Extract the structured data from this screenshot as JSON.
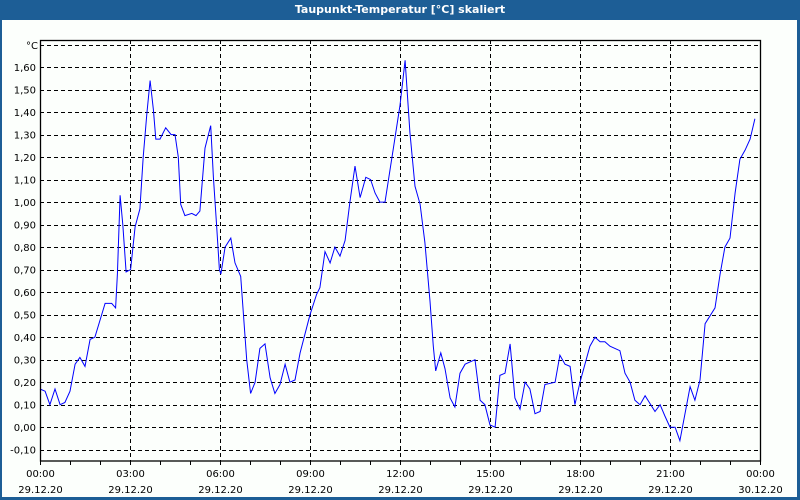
{
  "window": {
    "title": "Taupunkt-Temperatur [°C] skaliert"
  },
  "colors": {
    "titlebar": "#1d5e96",
    "line": "#0000ff",
    "grid": "#000000",
    "background": "#fcfffc"
  },
  "chart_data": {
    "type": "line",
    "title": "Taupunkt-Temperatur [°C] skaliert",
    "ylabel": "°C",
    "xlabel": "",
    "ylim": [
      -0.15,
      1.72
    ],
    "xlim_hours": [
      0,
      24
    ],
    "grid": true,
    "y_ticks": [
      "-0,10",
      "0,00",
      "0,10",
      "0,20",
      "0,30",
      "0,40",
      "0,50",
      "0,60",
      "0,70",
      "0,80",
      "0,90",
      "1,00",
      "1,10",
      "1,20",
      "1,30",
      "1,40",
      "1,50",
      "1,60"
    ],
    "y_tick_values": [
      -0.1,
      0,
      0.1,
      0.2,
      0.3,
      0.4,
      0.5,
      0.6,
      0.7,
      0.8,
      0.9,
      1.0,
      1.1,
      1.2,
      1.3,
      1.4,
      1.5,
      1.6
    ],
    "x_ticks": [
      {
        "hour": 0,
        "time": "00:00",
        "date": "29.12.20"
      },
      {
        "hour": 3,
        "time": "03:00",
        "date": "29.12.20"
      },
      {
        "hour": 6,
        "time": "06:00",
        "date": "29.12.20"
      },
      {
        "hour": 9,
        "time": "09:00",
        "date": "29.12.20"
      },
      {
        "hour": 12,
        "time": "12:00",
        "date": "29.12.20"
      },
      {
        "hour": 15,
        "time": "15:00",
        "date": "29.12.20"
      },
      {
        "hour": 18,
        "time": "18:00",
        "date": "29.12.20"
      },
      {
        "hour": 21,
        "time": "21:00",
        "date": "29.12.20"
      },
      {
        "hour": 24,
        "time": "00:00",
        "date": "30.12.20"
      }
    ],
    "series": [
      {
        "name": "Taupunkt-Temperatur",
        "points": [
          [
            0,
            0.17
          ],
          [
            0.17,
            0.16
          ],
          [
            0.33,
            0.1
          ],
          [
            0.5,
            0.17
          ],
          [
            0.67,
            0.1
          ],
          [
            0.83,
            0.11
          ],
          [
            1,
            0.16
          ],
          [
            1.17,
            0.28
          ],
          [
            1.33,
            0.31
          ],
          [
            1.5,
            0.27
          ],
          [
            1.67,
            0.39
          ],
          [
            1.83,
            0.4
          ],
          [
            2.17,
            0.55
          ],
          [
            2.39,
            0.55
          ],
          [
            2.52,
            0.53
          ],
          [
            2.58,
            0.68
          ],
          [
            2.67,
            1.03
          ],
          [
            2.76,
            0.9
          ],
          [
            2.87,
            0.69
          ],
          [
            3.02,
            0.7
          ],
          [
            3.17,
            0.89
          ],
          [
            3.33,
            0.97
          ],
          [
            3.44,
            1.2
          ],
          [
            3.56,
            1.39
          ],
          [
            3.67,
            1.54
          ],
          [
            3.78,
            1.41
          ],
          [
            3.86,
            1.28
          ],
          [
            4,
            1.28
          ],
          [
            4.19,
            1.33
          ],
          [
            4.37,
            1.3
          ],
          [
            4.5,
            1.3
          ],
          [
            4.61,
            1.2
          ],
          [
            4.69,
            0.99
          ],
          [
            4.83,
            0.94
          ],
          [
            5.06,
            0.95
          ],
          [
            5.2,
            0.94
          ],
          [
            5.33,
            0.96
          ],
          [
            5.5,
            1.24
          ],
          [
            5.69,
            1.34
          ],
          [
            5.78,
            1.11
          ],
          [
            5.89,
            0.89
          ],
          [
            5.98,
            0.7
          ],
          [
            6.03,
            0.68
          ],
          [
            6.17,
            0.8
          ],
          [
            6.36,
            0.84
          ],
          [
            6.5,
            0.73
          ],
          [
            6.69,
            0.67
          ],
          [
            6.89,
            0.3
          ],
          [
            7.02,
            0.15
          ],
          [
            7.17,
            0.2
          ],
          [
            7.33,
            0.35
          ],
          [
            7.5,
            0.37
          ],
          [
            7.67,
            0.22
          ],
          [
            7.83,
            0.15
          ],
          [
            8,
            0.19
          ],
          [
            8.17,
            0.28
          ],
          [
            8.33,
            0.2
          ],
          [
            8.5,
            0.21
          ],
          [
            8.67,
            0.33
          ],
          [
            9,
            0.5
          ],
          [
            9.22,
            0.59
          ],
          [
            9.33,
            0.62
          ],
          [
            9.5,
            0.78
          ],
          [
            9.67,
            0.73
          ],
          [
            9.83,
            0.8
          ],
          [
            10,
            0.76
          ],
          [
            10.17,
            0.83
          ],
          [
            10.33,
            1.0
          ],
          [
            10.5,
            1.16
          ],
          [
            10.67,
            1.02
          ],
          [
            10.86,
            1.11
          ],
          [
            11.02,
            1.1
          ],
          [
            11.17,
            1.04
          ],
          [
            11.33,
            1.0
          ],
          [
            11.5,
            1.0
          ],
          [
            11.78,
            1.24
          ],
          [
            12,
            1.43
          ],
          [
            12.17,
            1.63
          ],
          [
            12.33,
            1.31
          ],
          [
            12.5,
            1.07
          ],
          [
            12.67,
            0.99
          ],
          [
            12.83,
            0.82
          ],
          [
            13,
            0.56
          ],
          [
            13.11,
            0.36
          ],
          [
            13.19,
            0.25
          ],
          [
            13.36,
            0.33
          ],
          [
            13.5,
            0.26
          ],
          [
            13.67,
            0.13
          ],
          [
            13.83,
            0.09
          ],
          [
            14,
            0.24
          ],
          [
            14.17,
            0.28
          ],
          [
            14.5,
            0.3
          ],
          [
            14.67,
            0.12
          ],
          [
            14.83,
            0.1
          ],
          [
            15,
            0.01
          ],
          [
            15.17,
            0.0
          ],
          [
            15.33,
            0.23
          ],
          [
            15.5,
            0.24
          ],
          [
            15.67,
            0.37
          ],
          [
            15.83,
            0.13
          ],
          [
            16,
            0.08
          ],
          [
            16.17,
            0.2
          ],
          [
            16.33,
            0.17
          ],
          [
            16.5,
            0.06
          ],
          [
            16.67,
            0.07
          ],
          [
            16.83,
            0.19
          ],
          [
            17.17,
            0.2
          ],
          [
            17.33,
            0.32
          ],
          [
            17.5,
            0.28
          ],
          [
            17.67,
            0.27
          ],
          [
            17.83,
            0.1
          ],
          [
            18,
            0.2
          ],
          [
            18.33,
            0.36
          ],
          [
            18.5,
            0.4
          ],
          [
            18.67,
            0.38
          ],
          [
            18.83,
            0.38
          ],
          [
            19,
            0.36
          ],
          [
            19.33,
            0.34
          ],
          [
            19.5,
            0.24
          ],
          [
            19.67,
            0.2
          ],
          [
            19.83,
            0.12
          ],
          [
            20,
            0.1
          ],
          [
            20.17,
            0.14
          ],
          [
            20.5,
            0.07
          ],
          [
            20.67,
            0.1
          ],
          [
            20.83,
            0.05
          ],
          [
            21,
            0.0
          ],
          [
            21.17,
            0.0
          ],
          [
            21.33,
            -0.06
          ],
          [
            21.67,
            0.18
          ],
          [
            21.83,
            0.12
          ],
          [
            22,
            0.21
          ],
          [
            22.17,
            0.46
          ],
          [
            22.5,
            0.53
          ],
          [
            22.67,
            0.68
          ],
          [
            22.83,
            0.8
          ],
          [
            23,
            0.84
          ],
          [
            23.17,
            1.04
          ],
          [
            23.33,
            1.19
          ],
          [
            23.5,
            1.23
          ],
          [
            23.67,
            1.28
          ],
          [
            23.83,
            1.37
          ]
        ]
      }
    ]
  }
}
